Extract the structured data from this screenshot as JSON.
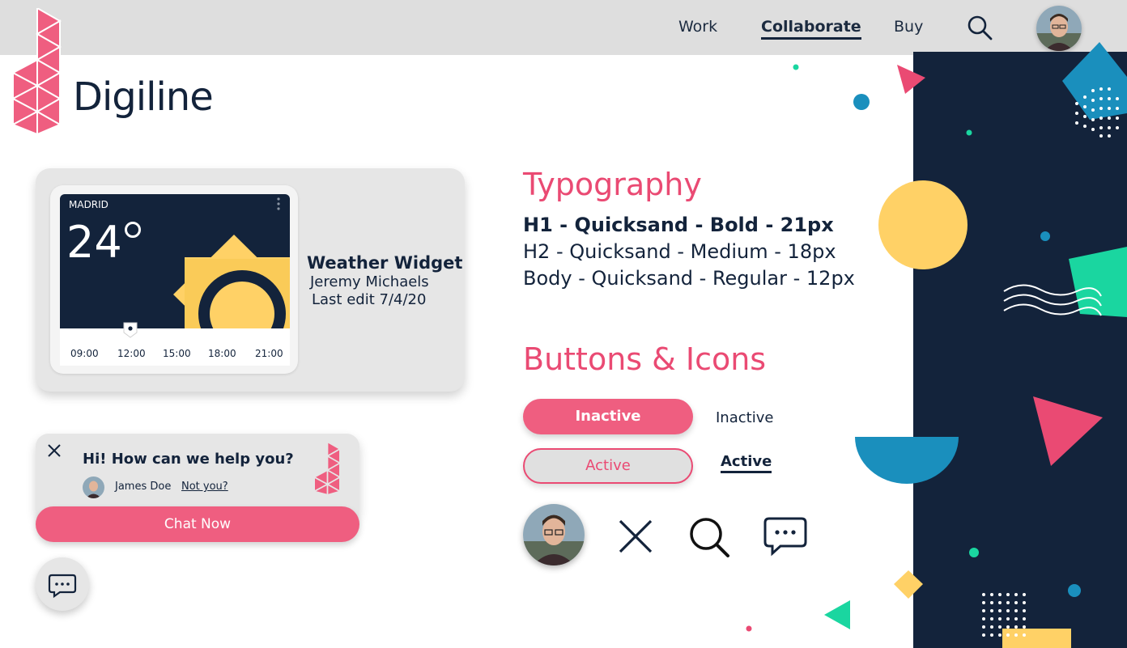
{
  "nav": {
    "items": [
      "Work",
      "Collaborate",
      "Buy"
    ],
    "active": "Collaborate"
  },
  "brand": {
    "name": "Digiline"
  },
  "weather_card": {
    "city": "MADRID",
    "temperature": "24",
    "times": [
      "09:00",
      "12:00",
      "15:00",
      "18:00",
      "21:00"
    ],
    "title": "Weather Widget",
    "author": "Jeremy Michaels",
    "last_edit": "Last edit 7/4/20"
  },
  "chat": {
    "title": "Hi! How can we help you?",
    "user": "James Doe",
    "not_you": "Not you?",
    "button": "Chat Now"
  },
  "typography": {
    "heading": "Typography",
    "h1": "H1 - Quicksand - Bold - 21px",
    "h2": "H2 - Quicksand - Medium - 18px",
    "body": "Body - Quicksand - Regular - 12px"
  },
  "buttons": {
    "heading": "Buttons & Icons",
    "inactive_button": "Inactive",
    "active_button": "Active",
    "inactive_link": "Inactive",
    "active_link": "Active"
  },
  "icons": [
    "avatar-icon",
    "close-icon",
    "search-icon",
    "chat-icon"
  ],
  "colors": {
    "navy": "#13233b",
    "pink": "#ea4a73",
    "yellow": "#ffd166",
    "teal": "#1a8fbd",
    "green": "#1ad6a0",
    "gray": "#dedede"
  }
}
